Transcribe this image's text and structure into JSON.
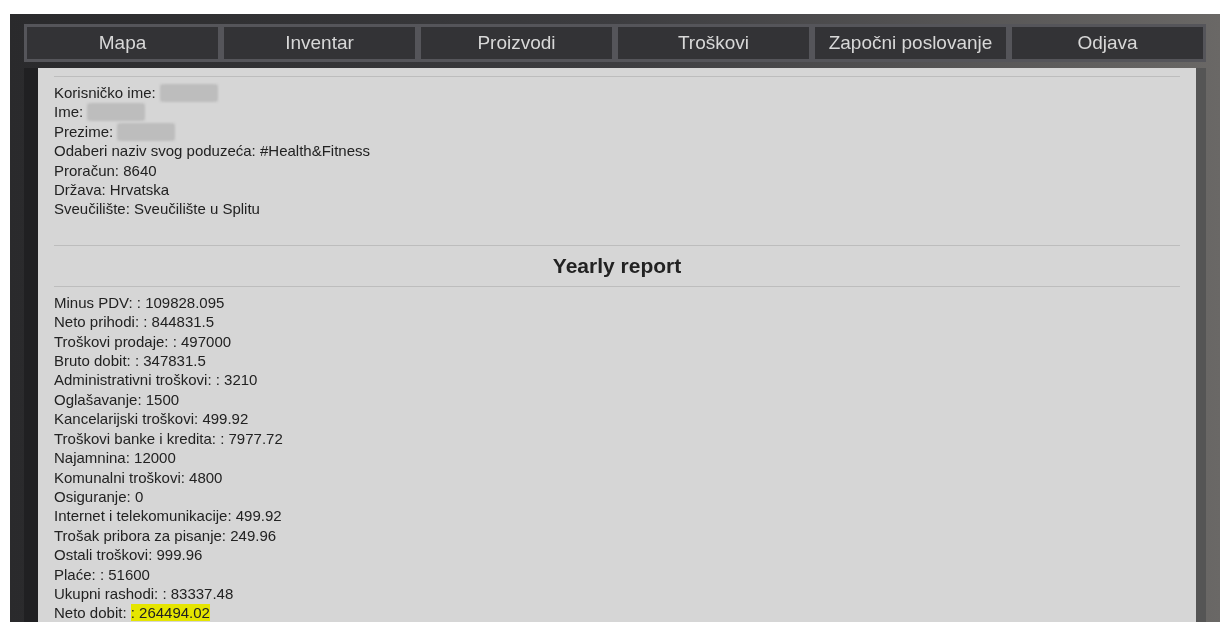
{
  "nav": [
    {
      "label": "Mapa"
    },
    {
      "label": "Inventar"
    },
    {
      "label": "Proizvodi"
    },
    {
      "label": "Troškovi"
    },
    {
      "label": "Započni poslovanje"
    },
    {
      "label": "Odjava"
    }
  ],
  "profile": [
    {
      "label": "Korisničko ime:",
      "redacted": true
    },
    {
      "label": "Ime:",
      "redacted": true
    },
    {
      "label": "Prezime:",
      "redacted": true
    },
    {
      "label": "Odaberi naziv svog poduzeća:",
      "value": "#Health&Fitness"
    },
    {
      "label": "Proračun:",
      "value": "8640"
    },
    {
      "label": "Država:",
      "value": "Hrvatska"
    },
    {
      "label": "Sveučilište:",
      "value": "Sveučilište u Splitu"
    }
  ],
  "report": {
    "title": "Yearly report",
    "lines": [
      {
        "label": "Minus PDV:",
        "value": ": 109828.095",
        "highlighted": false
      },
      {
        "label": "Neto prihodi:",
        "value": ": 844831.5",
        "highlighted": false
      },
      {
        "label": "Troškovi prodaje:",
        "value": ": 497000",
        "highlighted": false
      },
      {
        "label": "Bruto dobit:",
        "value": ": 347831.5",
        "highlighted": false
      },
      {
        "label": "Administrativni troškovi:",
        "value": ": 3210",
        "highlighted": false
      },
      {
        "label": "Oglašavanje:",
        "value": "1500",
        "highlighted": false
      },
      {
        "label": "Kancelarijski troškovi:",
        "value": "499.92",
        "highlighted": false
      },
      {
        "label": "Troškovi banke i kredita:",
        "value": ": 7977.72",
        "highlighted": false
      },
      {
        "label": "Najamnina:",
        "value": "12000",
        "highlighted": false
      },
      {
        "label": "Komunalni troškovi:",
        "value": "4800",
        "highlighted": false
      },
      {
        "label": "Osiguranje:",
        "value": "0",
        "highlighted": false
      },
      {
        "label": "Internet i telekomunikacije:",
        "value": "499.92",
        "highlighted": false
      },
      {
        "label": "Trošak pribora za pisanje:",
        "value": "249.96",
        "highlighted": false
      },
      {
        "label": "Ostali troškovi:",
        "value": "999.96",
        "highlighted": false
      },
      {
        "label": "Plaće:",
        "value": ": 51600",
        "highlighted": false
      },
      {
        "label": "Ukupni rashodi:",
        "value": ": 83337.48",
        "highlighted": false
      },
      {
        "label": "Neto dobit:",
        "value": ": 264494.02",
        "highlighted": true
      }
    ]
  }
}
